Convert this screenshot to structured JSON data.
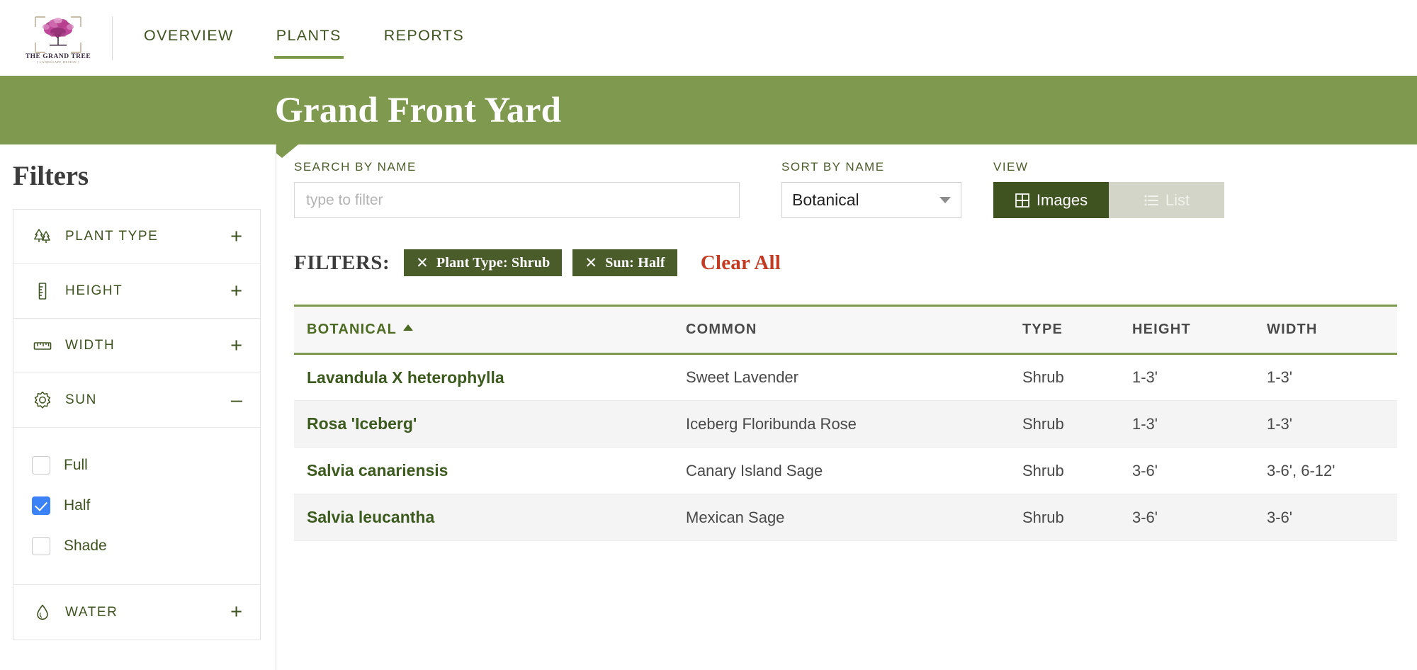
{
  "brand": {
    "name": "THE GRAND TREE",
    "tagline": "LANDSCAPE DESIGN",
    "logo_icon": "tree-logo-icon"
  },
  "nav": {
    "items": [
      {
        "label": "OVERVIEW",
        "active": false
      },
      {
        "label": "PLANTS",
        "active": true
      },
      {
        "label": "REPORTS",
        "active": false
      }
    ]
  },
  "banner": {
    "title": "Grand Front Yard",
    "background_color": "#7f9a4e"
  },
  "sidebar": {
    "heading": "Filters",
    "groups": [
      {
        "label": "PLANT TYPE",
        "icon": "trees-icon",
        "toggle": "+",
        "expanded": false
      },
      {
        "label": "HEIGHT",
        "icon": "vertical-ruler-icon",
        "toggle": "+",
        "expanded": false
      },
      {
        "label": "WIDTH",
        "icon": "horizontal-ruler-icon",
        "toggle": "+",
        "expanded": false
      },
      {
        "label": "SUN",
        "icon": "sun-icon",
        "toggle": "–",
        "expanded": true
      },
      {
        "label": "WATER",
        "icon": "water-drop-icon",
        "toggle": "+",
        "expanded": false
      }
    ],
    "sun_options": [
      {
        "label": "Full",
        "checked": false
      },
      {
        "label": "Half",
        "checked": true
      },
      {
        "label": "Shade",
        "checked": false
      }
    ]
  },
  "controls": {
    "search": {
      "label": "SEARCH BY NAME",
      "placeholder": "type to filter",
      "value": ""
    },
    "sort": {
      "label": "SORT BY NAME",
      "selected": "Botanical",
      "caret_icon": "chevron-down-icon"
    },
    "view": {
      "label": "VIEW",
      "options": [
        {
          "label": "Images",
          "icon": "grid-icon",
          "active": true
        },
        {
          "label": "List",
          "icon": "list-icon",
          "active": false
        }
      ]
    }
  },
  "active_filters": {
    "title": "FILTERS:",
    "chips": [
      {
        "remove_icon": "close-icon",
        "label": "Plant Type: Shrub"
      },
      {
        "remove_icon": "close-icon",
        "label": "Sun: Half"
      }
    ],
    "clear_all": "Clear All",
    "clear_all_color": "#c23b22"
  },
  "table": {
    "columns": [
      {
        "key": "botanical",
        "label": "BOTANICAL",
        "sorted": true,
        "sort_direction": "asc"
      },
      {
        "key": "common",
        "label": "COMMON",
        "sorted": false
      },
      {
        "key": "type",
        "label": "TYPE",
        "sorted": false
      },
      {
        "key": "height",
        "label": "HEIGHT",
        "sorted": false
      },
      {
        "key": "width",
        "label": "WIDTH",
        "sorted": false
      }
    ],
    "rows": [
      {
        "botanical": "Lavandula X heterophylla",
        "common": "Sweet Lavender",
        "type": "Shrub",
        "height": "1-3'",
        "width": "1-3'"
      },
      {
        "botanical": "Rosa 'Iceberg'",
        "common": "Iceberg Floribunda Rose",
        "type": "Shrub",
        "height": "1-3'",
        "width": "1-3'"
      },
      {
        "botanical": "Salvia canariensis",
        "common": "Canary Island Sage",
        "type": "Shrub",
        "height": "3-6'",
        "width": "3-6', 6-12'"
      },
      {
        "botanical": "Salvia leucantha",
        "common": "Mexican Sage",
        "type": "Shrub",
        "height": "3-6'",
        "width": "3-6'"
      }
    ]
  },
  "colors": {
    "brand_green": "#7f9a4e",
    "dark_green": "#3f5320",
    "chip_green": "#4b5c2b",
    "accent_red": "#c23b22",
    "checkbox_blue": "#3B82F6"
  }
}
